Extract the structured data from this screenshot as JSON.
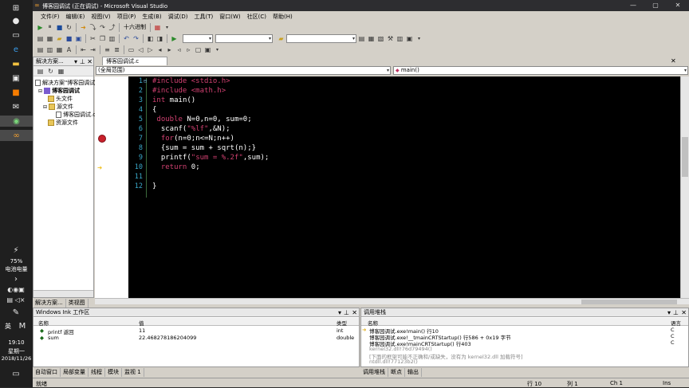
{
  "taskbar": {
    "battery_percent": "75%",
    "battery_label": "电池电量",
    "ime": "英",
    "time": "19:10",
    "weekday": "星期一",
    "date": "2018/11/26"
  },
  "window": {
    "title": "博客园调试 (正在调试) - Microsoft Visual Studio"
  },
  "menu": [
    "文件(F)",
    "编辑(E)",
    "视图(V)",
    "项目(P)",
    "生成(B)",
    "调试(D)",
    "工具(T)",
    "窗口(W)",
    "社区(C)",
    "帮助(H)"
  ],
  "toolbar": {
    "hex_label": "十六进制"
  },
  "solution": {
    "header": "解决方案...",
    "solution_name": "解决方案\"博客园调试\"(1",
    "project_name": "博客园调试",
    "folders": [
      "头文件",
      "源文件",
      "资源文件"
    ],
    "source_file": "博客园调试.c"
  },
  "editor": {
    "tab_label": "博客园调试.c",
    "scope_combo": "(全局范围)",
    "func_combo": "main()",
    "line_numbers": [
      "1",
      "2",
      "3",
      "4",
      "5",
      "6",
      "7",
      "8",
      "9",
      "10",
      "11",
      "12"
    ]
  },
  "left_tabs": [
    "解决方案...",
    "类视图"
  ],
  "watch": {
    "title": "Windows Ink 工作区",
    "columns": [
      "名称",
      "值",
      "类型"
    ],
    "rows": [
      {
        "name": "printf 返回",
        "value": "11",
        "type": "int"
      },
      {
        "name": "sum",
        "value": "22.468278186204099",
        "type": "double"
      }
    ]
  },
  "callstack": {
    "title": "调用堆栈",
    "columns": [
      "名称",
      "语言"
    ],
    "rows": [
      {
        "text": "博客园调试.exe!main()  行10",
        "lang": "C"
      },
      {
        "text": "博客园调试.exe!__tmainCRTStartup()  行586 + 0x19 字节",
        "lang": "C"
      },
      {
        "text": "博客园调试.exe!mainCRTStartup()  行403",
        "lang": "C"
      },
      {
        "text": "kernel32.dll!76d79494()",
        "lang": ""
      },
      {
        "text": "[下面的框架可能不正确和/或缺失，没有为 kernel32.dll 加载符号]",
        "lang": ""
      },
      {
        "text": "ntdll.dll!77123b2()",
        "lang": ""
      }
    ]
  },
  "bottom_tabs_left": [
    "自动窗口",
    "局部变量",
    "线程",
    "模块",
    "监视 1"
  ],
  "bottom_tabs_right": [
    "调用堆栈",
    "断点",
    "输出"
  ],
  "status": {
    "ready": "就绪",
    "line": "行 10",
    "col": "列 1",
    "ch": "Ch 1",
    "mode": "Ins"
  },
  "colors": {
    "keyword": "#d04070",
    "line_number": "#3aa8c8",
    "editor_bg": "#000000"
  }
}
